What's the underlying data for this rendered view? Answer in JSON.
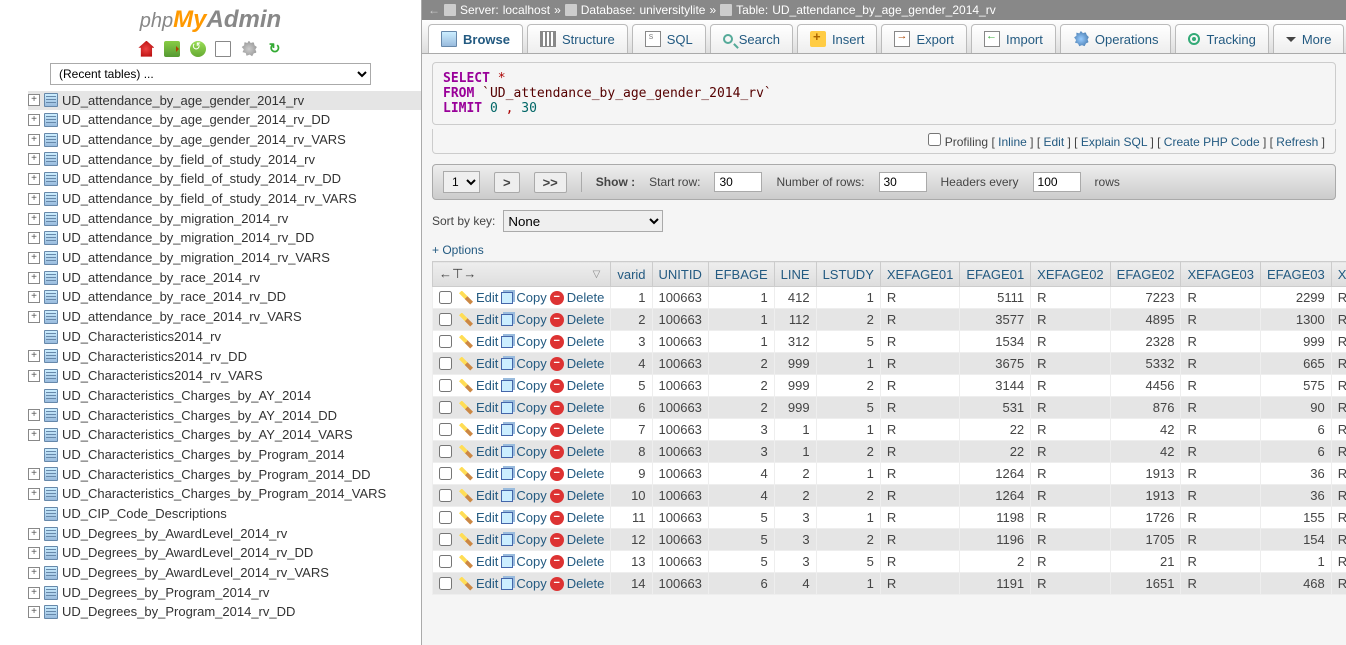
{
  "logo": {
    "php": "php",
    "my": "My",
    "admin": "Admin"
  },
  "recent_placeholder": "(Recent tables) ...",
  "breadcrumb": {
    "server_label": "Server:",
    "server": "localhost",
    "db_label": "Database:",
    "db": "universitylite",
    "table_label": "Table:",
    "table": "UD_attendance_by_age_gender_2014_rv"
  },
  "tabs": {
    "browse": "Browse",
    "structure": "Structure",
    "sql": "SQL",
    "search": "Search",
    "insert": "Insert",
    "export": "Export",
    "import": "Import",
    "operations": "Operations",
    "tracking": "Tracking",
    "more": "More"
  },
  "sql": {
    "select": "SELECT",
    "star": "*",
    "from": "FROM",
    "table": "`UD_attendance_by_age_gender_2014_rv`",
    "limit": "LIMIT",
    "n1": "0",
    "comma": ",",
    "n2": "30"
  },
  "sql_actions": {
    "profiling": "Profiling",
    "inline": "Inline",
    "edit": "Edit",
    "explain": "Explain SQL",
    "create_php": "Create PHP Code",
    "refresh": "Refresh"
  },
  "nav": {
    "page": "1",
    "next": ">",
    "last": ">>",
    "show": "Show :",
    "start_row_label": "Start row:",
    "start_row": "30",
    "num_rows_label": "Number of rows:",
    "num_rows": "30",
    "headers_label": "Headers every",
    "headers": "100",
    "rows": "rows"
  },
  "sort": {
    "label": "Sort by key:",
    "value": "None"
  },
  "options": "+ Options",
  "columns": [
    "varid",
    "UNITID",
    "EFBAGE",
    "LINE",
    "LSTUDY",
    "XEFAGE01",
    "EFAGE01",
    "XEFAGE02",
    "EFAGE02",
    "XEFAGE03",
    "EFAGE03",
    "XEFA"
  ],
  "actions": {
    "edit": "Edit",
    "copy": "Copy",
    "delete": "Delete"
  },
  "rows": [
    {
      "varid": 1,
      "UNITID": 100663,
      "EFBAGE": 1,
      "LINE": 412,
      "LSTUDY": 1,
      "XEFAGE01": "R",
      "EFAGE01": 5111,
      "XEFAGE02": "R",
      "EFAGE02": 7223,
      "XEFAGE03": "R",
      "EFAGE03": 2299,
      "XEFA": "R"
    },
    {
      "varid": 2,
      "UNITID": 100663,
      "EFBAGE": 1,
      "LINE": 112,
      "LSTUDY": 2,
      "XEFAGE01": "R",
      "EFAGE01": 3577,
      "XEFAGE02": "R",
      "EFAGE02": 4895,
      "XEFAGE03": "R",
      "EFAGE03": 1300,
      "XEFA": "R"
    },
    {
      "varid": 3,
      "UNITID": 100663,
      "EFBAGE": 1,
      "LINE": 312,
      "LSTUDY": 5,
      "XEFAGE01": "R",
      "EFAGE01": 1534,
      "XEFAGE02": "R",
      "EFAGE02": 2328,
      "XEFAGE03": "R",
      "EFAGE03": 999,
      "XEFA": "R"
    },
    {
      "varid": 4,
      "UNITID": 100663,
      "EFBAGE": 2,
      "LINE": 999,
      "LSTUDY": 1,
      "XEFAGE01": "R",
      "EFAGE01": 3675,
      "XEFAGE02": "R",
      "EFAGE02": 5332,
      "XEFAGE03": "R",
      "EFAGE03": 665,
      "XEFA": "R"
    },
    {
      "varid": 5,
      "UNITID": 100663,
      "EFBAGE": 2,
      "LINE": 999,
      "LSTUDY": 2,
      "XEFAGE01": "R",
      "EFAGE01": 3144,
      "XEFAGE02": "R",
      "EFAGE02": 4456,
      "XEFAGE03": "R",
      "EFAGE03": 575,
      "XEFA": "R"
    },
    {
      "varid": 6,
      "UNITID": 100663,
      "EFBAGE": 2,
      "LINE": 999,
      "LSTUDY": 5,
      "XEFAGE01": "R",
      "EFAGE01": 531,
      "XEFAGE02": "R",
      "EFAGE02": 876,
      "XEFAGE03": "R",
      "EFAGE03": 90,
      "XEFA": "R"
    },
    {
      "varid": 7,
      "UNITID": 100663,
      "EFBAGE": 3,
      "LINE": 1,
      "LSTUDY": 1,
      "XEFAGE01": "R",
      "EFAGE01": 22,
      "XEFAGE02": "R",
      "EFAGE02": 42,
      "XEFAGE03": "R",
      "EFAGE03": 6,
      "XEFA": "R"
    },
    {
      "varid": 8,
      "UNITID": 100663,
      "EFBAGE": 3,
      "LINE": 1,
      "LSTUDY": 2,
      "XEFAGE01": "R",
      "EFAGE01": 22,
      "XEFAGE02": "R",
      "EFAGE02": 42,
      "XEFAGE03": "R",
      "EFAGE03": 6,
      "XEFA": "R"
    },
    {
      "varid": 9,
      "UNITID": 100663,
      "EFBAGE": 4,
      "LINE": 2,
      "LSTUDY": 1,
      "XEFAGE01": "R",
      "EFAGE01": 1264,
      "XEFAGE02": "R",
      "EFAGE02": 1913,
      "XEFAGE03": "R",
      "EFAGE03": 36,
      "XEFA": "R"
    },
    {
      "varid": 10,
      "UNITID": 100663,
      "EFBAGE": 4,
      "LINE": 2,
      "LSTUDY": 2,
      "XEFAGE01": "R",
      "EFAGE01": 1264,
      "XEFAGE02": "R",
      "EFAGE02": 1913,
      "XEFAGE03": "R",
      "EFAGE03": 36,
      "XEFA": "R"
    },
    {
      "varid": 11,
      "UNITID": 100663,
      "EFBAGE": 5,
      "LINE": 3,
      "LSTUDY": 1,
      "XEFAGE01": "R",
      "EFAGE01": 1198,
      "XEFAGE02": "R",
      "EFAGE02": 1726,
      "XEFAGE03": "R",
      "EFAGE03": 155,
      "XEFA": "R"
    },
    {
      "varid": 12,
      "UNITID": 100663,
      "EFBAGE": 5,
      "LINE": 3,
      "LSTUDY": 2,
      "XEFAGE01": "R",
      "EFAGE01": 1196,
      "XEFAGE02": "R",
      "EFAGE02": 1705,
      "XEFAGE03": "R",
      "EFAGE03": 154,
      "XEFA": "R"
    },
    {
      "varid": 13,
      "UNITID": 100663,
      "EFBAGE": 5,
      "LINE": 3,
      "LSTUDY": 5,
      "XEFAGE01": "R",
      "EFAGE01": 2,
      "XEFAGE02": "R",
      "EFAGE02": 21,
      "XEFAGE03": "R",
      "EFAGE03": 1,
      "XEFA": "R"
    },
    {
      "varid": 14,
      "UNITID": 100663,
      "EFBAGE": 6,
      "LINE": 4,
      "LSTUDY": 1,
      "XEFAGE01": "R",
      "EFAGE01": 1191,
      "XEFAGE02": "R",
      "EFAGE02": 1651,
      "XEFAGE03": "R",
      "EFAGE03": 468,
      "XEFA": "R"
    }
  ],
  "tree": [
    {
      "n": "UD_attendance_by_age_gender_2014_rv",
      "sel": true,
      "p": true
    },
    {
      "n": "UD_attendance_by_age_gender_2014_rv_DD",
      "p": true
    },
    {
      "n": "UD_attendance_by_age_gender_2014_rv_VARS",
      "p": true
    },
    {
      "n": "UD_attendance_by_field_of_study_2014_rv",
      "p": true
    },
    {
      "n": "UD_attendance_by_field_of_study_2014_rv_DD",
      "p": true
    },
    {
      "n": "UD_attendance_by_field_of_study_2014_rv_VARS",
      "p": true
    },
    {
      "n": "UD_attendance_by_migration_2014_rv",
      "p": true
    },
    {
      "n": "UD_attendance_by_migration_2014_rv_DD",
      "p": true
    },
    {
      "n": "UD_attendance_by_migration_2014_rv_VARS",
      "p": true
    },
    {
      "n": "UD_attendance_by_race_2014_rv",
      "p": true
    },
    {
      "n": "UD_attendance_by_race_2014_rv_DD",
      "p": true
    },
    {
      "n": "UD_attendance_by_race_2014_rv_VARS",
      "p": true
    },
    {
      "n": "UD_Characteristics2014_rv",
      "p": false
    },
    {
      "n": "UD_Characteristics2014_rv_DD",
      "p": true
    },
    {
      "n": "UD_Characteristics2014_rv_VARS",
      "p": true
    },
    {
      "n": "UD_Characteristics_Charges_by_AY_2014",
      "p": false
    },
    {
      "n": "UD_Characteristics_Charges_by_AY_2014_DD",
      "p": true
    },
    {
      "n": "UD_Characteristics_Charges_by_AY_2014_VARS",
      "p": true
    },
    {
      "n": "UD_Characteristics_Charges_by_Program_2014",
      "p": false
    },
    {
      "n": "UD_Characteristics_Charges_by_Program_2014_DD",
      "p": true
    },
    {
      "n": "UD_Characteristics_Charges_by_Program_2014_VARS",
      "p": true
    },
    {
      "n": "UD_CIP_Code_Descriptions",
      "p": false
    },
    {
      "n": "UD_Degrees_by_AwardLevel_2014_rv",
      "p": true
    },
    {
      "n": "UD_Degrees_by_AwardLevel_2014_rv_DD",
      "p": true
    },
    {
      "n": "UD_Degrees_by_AwardLevel_2014_rv_VARS",
      "p": true
    },
    {
      "n": "UD_Degrees_by_Program_2014_rv",
      "p": true
    },
    {
      "n": "UD_Degrees_by_Program_2014_rv_DD",
      "p": true
    }
  ]
}
